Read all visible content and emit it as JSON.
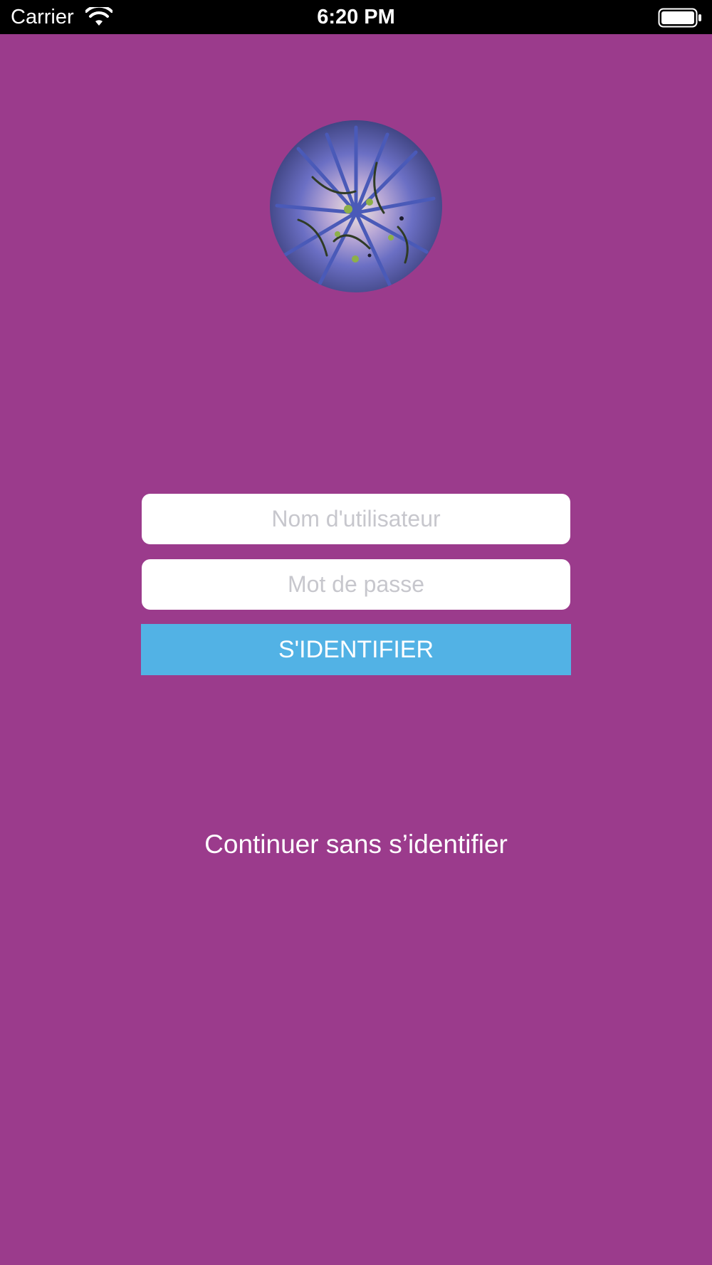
{
  "status_bar": {
    "carrier": "Carrier",
    "time": "6:20 PM",
    "wifi_icon": "wifi-icon",
    "battery_icon": "battery-icon"
  },
  "avatar": {
    "icon": "thistle-flower-photo"
  },
  "login_form": {
    "username_placeholder": "Nom d'utilisateur",
    "password_placeholder": "Mot de passe",
    "submit_label": "S'IDENTIFIER"
  },
  "skip_link_label": "Continuer sans s’identifier",
  "colors": {
    "background": "#9b3b8c",
    "button": "#52b2e5",
    "status_bar": "#000000"
  }
}
